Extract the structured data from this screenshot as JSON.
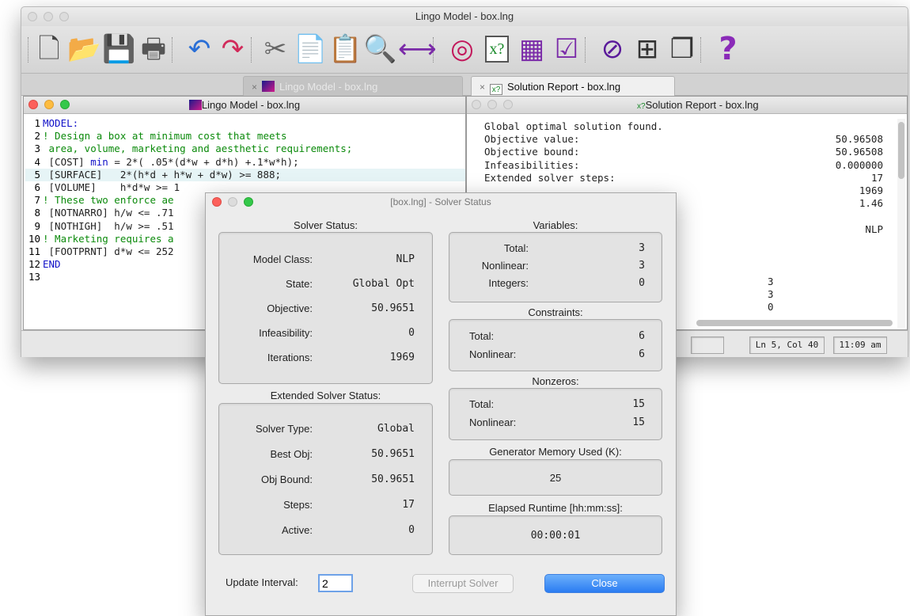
{
  "main_window": {
    "title": "Lingo Model - box.lng",
    "toolbar": [
      {
        "name": "new-file-icon",
        "glyph": "🗋",
        "color": "#444"
      },
      {
        "name": "open-file-icon",
        "glyph": "📂",
        "color": "#555"
      },
      {
        "name": "save-icon",
        "glyph": "💾",
        "color": "#7a2aa8"
      },
      {
        "name": "print-icon",
        "glyph": "🖶",
        "color": "#555"
      },
      {
        "name": "undo-icon",
        "glyph": "↶",
        "color": "#2a6fd6"
      },
      {
        "name": "redo-icon",
        "glyph": "↷",
        "color": "#d12a5a"
      },
      {
        "name": "cut-icon",
        "glyph": "✂",
        "color": "#666"
      },
      {
        "name": "copy-icon",
        "glyph": "📄",
        "color": "#777"
      },
      {
        "name": "paste-icon",
        "glyph": "📋",
        "color": "#444"
      },
      {
        "name": "find-icon",
        "glyph": "🔍",
        "color": "#2a6fd6"
      },
      {
        "name": "match-parenthesis-icon",
        "glyph": "⟷",
        "color": "#7a2aa8"
      },
      {
        "name": "solve-target-icon",
        "glyph": "◎",
        "color": "#c2185b"
      },
      {
        "name": "solution-icon",
        "glyph": "x?",
        "color": "#1a8a2a"
      },
      {
        "name": "matrix-picture-icon",
        "glyph": "▦",
        "color": "#7a2aa8"
      },
      {
        "name": "options-check-icon",
        "glyph": "☑",
        "color": "#7a2aa8"
      },
      {
        "name": "close-all-icon",
        "glyph": "⊘",
        "color": "#5a1a9a"
      },
      {
        "name": "tile-windows-icon",
        "glyph": "⊞",
        "color": "#333"
      },
      {
        "name": "cascade-windows-icon",
        "glyph": "❐",
        "color": "#333"
      },
      {
        "name": "help-icon",
        "glyph": "?",
        "color": "#8a2ab8"
      }
    ],
    "tabs": [
      {
        "label": "Lingo Model - box.lng",
        "active": false
      },
      {
        "label": "Solution Report - box.lng",
        "active": true
      }
    ],
    "status": {
      "position": "Ln 5, Col 40",
      "time": "11:09 am"
    }
  },
  "model_window": {
    "title": "Lingo Model - box.lng",
    "lines": [
      {
        "n": "1",
        "parts": [
          {
            "t": "MODEL:",
            "c": "kw"
          }
        ]
      },
      {
        "n": "2",
        "parts": [
          {
            "t": "! Design a box at minimum cost that meets",
            "c": "cm"
          }
        ]
      },
      {
        "n": "3",
        "parts": [
          {
            "t": " area, volume, marketing and aesthetic requirements;",
            "c": "cm"
          }
        ]
      },
      {
        "n": "4",
        "parts": [
          {
            "t": " [COST] ",
            "c": ""
          },
          {
            "t": "min",
            "c": "kw"
          },
          {
            "t": " = 2*( .05*(d*w + d*h) +.1*w*h);",
            "c": ""
          }
        ]
      },
      {
        "n": "5",
        "parts": [
          {
            "t": " [SURFACE]   2*(h*d + h*w + d*w) >= 888;",
            "c": ""
          }
        ],
        "hl": true
      },
      {
        "n": "6",
        "parts": [
          {
            "t": " [VOLUME]    h*d*w >= 1",
            "c": ""
          }
        ]
      },
      {
        "n": "7",
        "parts": [
          {
            "t": "! These two enforce ae",
            "c": "cm"
          }
        ]
      },
      {
        "n": "8",
        "parts": [
          {
            "t": " [NOTNARRO] h/w <= .71",
            "c": ""
          }
        ]
      },
      {
        "n": "9",
        "parts": [
          {
            "t": " [NOTHIGH]  h/w >= .51",
            "c": ""
          }
        ]
      },
      {
        "n": "10",
        "parts": [
          {
            "t": "! Marketing requires a",
            "c": "cm"
          }
        ]
      },
      {
        "n": "11",
        "parts": [
          {
            "t": " [FOOTPRNT] d*w <= 252",
            "c": ""
          }
        ]
      },
      {
        "n": "12",
        "parts": [
          {
            "t": "END",
            "c": "kw"
          }
        ]
      },
      {
        "n": "13",
        "parts": [
          {
            "t": "",
            "c": ""
          }
        ]
      }
    ]
  },
  "report_window": {
    "title": "Solution Report - box.lng",
    "header": "Global optimal solution found.",
    "rows": [
      {
        "label": "Objective value:",
        "value": "50.96508"
      },
      {
        "label": "Objective bound:",
        "value": "50.96508"
      },
      {
        "label": "Infeasibilities:",
        "value": "0.000000"
      },
      {
        "label": "Extended solver steps:",
        "value": "17"
      },
      {
        "label": "",
        "value": "1969"
      },
      {
        "label": "",
        "value": "1.46"
      },
      {
        "label": "",
        "value": ""
      },
      {
        "label": "",
        "value": "NLP"
      }
    ],
    "small_values": [
      "3",
      "3",
      "0"
    ]
  },
  "solver_dialog": {
    "title": "[box.lng] - Solver Status",
    "solver_status": {
      "title": "Solver Status:",
      "rows": [
        {
          "label": "Model Class:",
          "value": "NLP"
        },
        {
          "label": "State:",
          "value": "Global Opt"
        },
        {
          "label": "Objective:",
          "value": "50.9651"
        },
        {
          "label": "Infeasibility:",
          "value": "0"
        },
        {
          "label": "Iterations:",
          "value": "1969"
        }
      ]
    },
    "extended": {
      "title": "Extended Solver Status:",
      "rows": [
        {
          "label": "Solver Type:",
          "value": "Global"
        },
        {
          "label": "Best Obj:",
          "value": "50.9651"
        },
        {
          "label": "Obj Bound:",
          "value": "50.9651"
        },
        {
          "label": "Steps:",
          "value": "17"
        },
        {
          "label": "Active:",
          "value": "0"
        }
      ]
    },
    "variables": {
      "title": "Variables:",
      "rows": [
        {
          "label": "Total:",
          "value": "3"
        },
        {
          "label": "Nonlinear:",
          "value": "3"
        },
        {
          "label": "Integers:",
          "value": "0"
        }
      ]
    },
    "constraints": {
      "title": "Constraints:",
      "rows": [
        {
          "label": "Total:",
          "value": "6"
        },
        {
          "label": "Nonlinear:",
          "value": "6"
        }
      ]
    },
    "nonzeros": {
      "title": "Nonzeros:",
      "rows": [
        {
          "label": "Total:",
          "value": "15"
        },
        {
          "label": "Nonlinear:",
          "value": "15"
        }
      ]
    },
    "memory": {
      "title": "Generator Memory Used (K):",
      "value": "25"
    },
    "runtime": {
      "title": "Elapsed Runtime [hh:mm:ss]:",
      "value": "00:00:01"
    },
    "update_interval": {
      "label": "Update Interval:",
      "value": "2"
    },
    "interrupt_label": "Interrupt Solver",
    "close_label": "Close"
  }
}
